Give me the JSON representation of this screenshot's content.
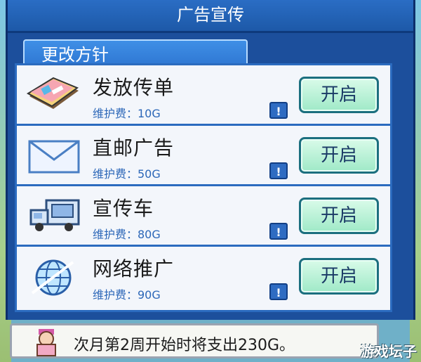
{
  "window": {
    "title": "广告宣传"
  },
  "tab": {
    "label": "更改方针"
  },
  "items": [
    {
      "name": "发放传单",
      "fee": "维护费：10G",
      "button": "开启",
      "info": "!",
      "icon": "flyer-icon"
    },
    {
      "name": "直邮广告",
      "fee": "维护费：50G",
      "button": "开启",
      "info": "!",
      "icon": "envelope-icon"
    },
    {
      "name": "宣传车",
      "fee": "维护费：80G",
      "button": "开启",
      "info": "!",
      "icon": "truck-icon"
    },
    {
      "name": "网络推广",
      "fee": "维护费：90G",
      "button": "开启",
      "info": "!",
      "icon": "globe-icon"
    }
  ],
  "message": {
    "text": "次月第2周开始时将支出230G。"
  },
  "watermark": "游戏坛子",
  "colors": {
    "accent": "#1c4f9c",
    "button": "#9fe9c7",
    "fee_text": "#2c67b8"
  }
}
